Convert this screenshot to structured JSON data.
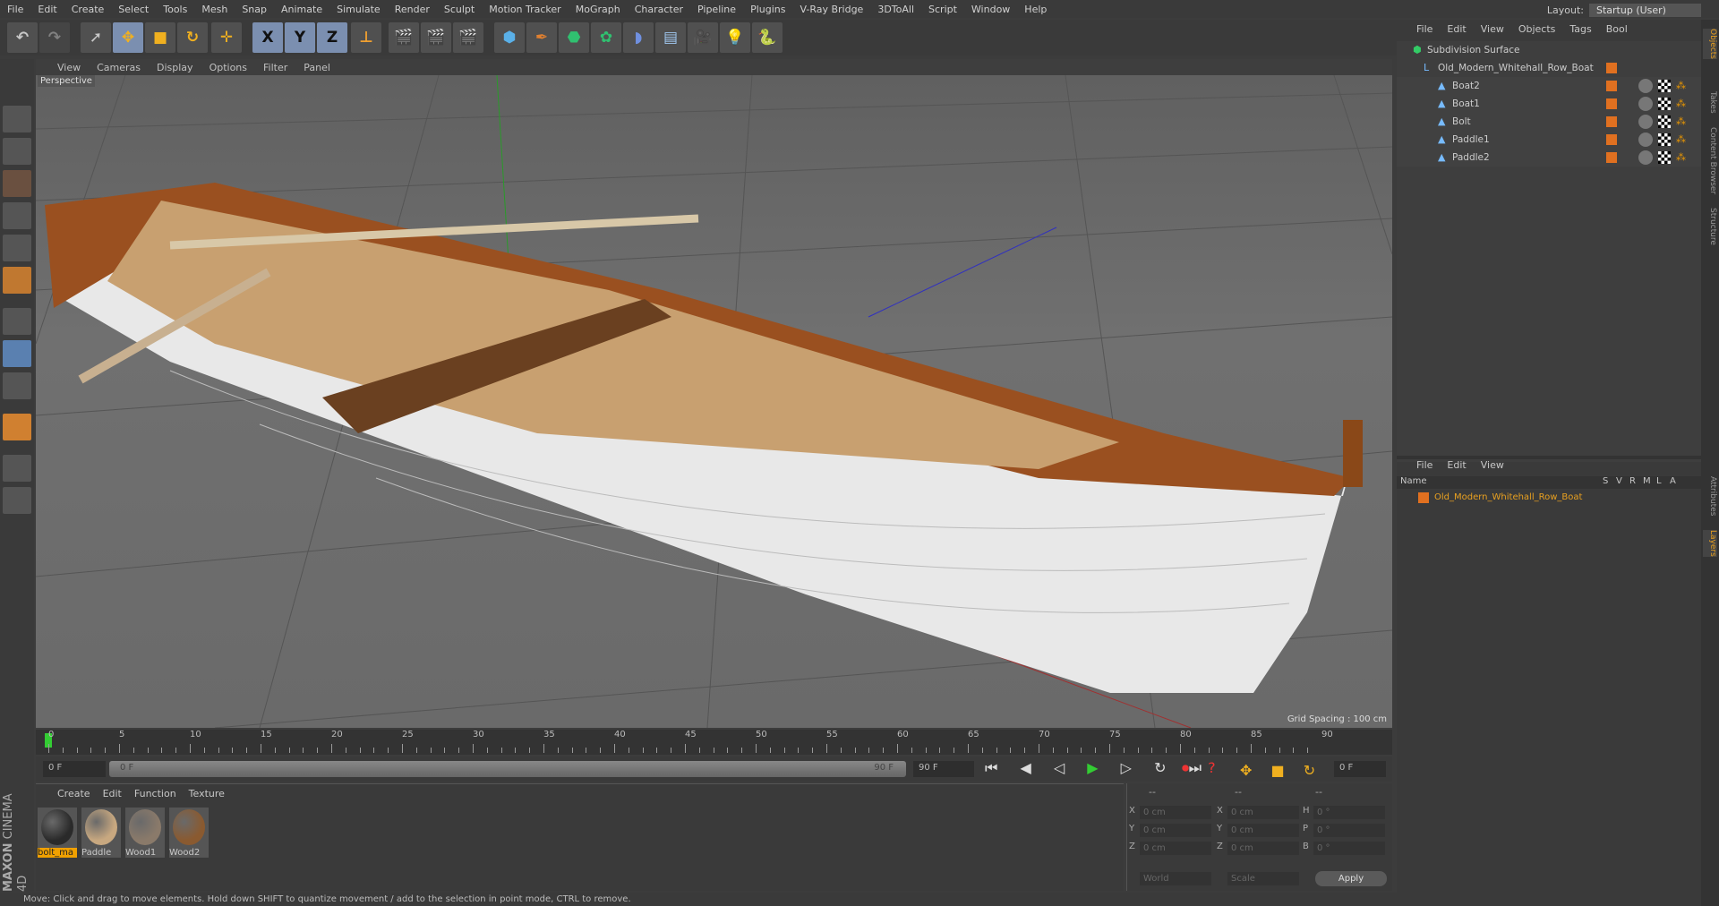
{
  "menu": [
    "File",
    "Edit",
    "Create",
    "Select",
    "Tools",
    "Mesh",
    "Snap",
    "Animate",
    "Simulate",
    "Render",
    "Sculpt",
    "Motion Tracker",
    "MoGraph",
    "Character",
    "Pipeline",
    "Plugins",
    "V-Ray Bridge",
    "3DToAll",
    "Script",
    "Window",
    "Help"
  ],
  "layout": {
    "label": "Layout:",
    "value": "Startup (User)"
  },
  "toolbar": {
    "x": "X",
    "y": "Y",
    "z": "Z"
  },
  "viewport": {
    "menu": [
      "View",
      "Cameras",
      "Display",
      "Options",
      "Filter",
      "Panel"
    ],
    "camera": "Perspective",
    "grid_spacing": "Grid Spacing : 100 cm"
  },
  "timeline": {
    "ticks": [
      "0",
      "5",
      "10",
      "15",
      "20",
      "25",
      "30",
      "35",
      "40",
      "45",
      "50",
      "55",
      "60",
      "65",
      "70",
      "75",
      "80",
      "85",
      "90"
    ],
    "current_frame": "0 F",
    "start": "0 F",
    "slider_start": "0 F",
    "slider_end": "90 F",
    "end": "90 F",
    "right_frame": "0 F"
  },
  "materials": {
    "menu": [
      "Create",
      "Edit",
      "Function",
      "Texture"
    ],
    "items": [
      {
        "name": "bolt_ma",
        "color": "#2a2a2a"
      },
      {
        "name": "Paddle",
        "color": "#c8a880"
      },
      {
        "name": "Wood1",
        "color": "#8a7a6a"
      },
      {
        "name": "Wood2",
        "color": "#8a5a30"
      }
    ],
    "brand1": "MAXON",
    "brand2": "CINEMA 4D"
  },
  "coords": {
    "headers": [
      "--",
      "--",
      "--"
    ],
    "rows": [
      {
        "a": "X",
        "av": "0 cm",
        "b": "X",
        "bv": "0 cm",
        "c": "H",
        "cv": "0 °"
      },
      {
        "a": "Y",
        "av": "0 cm",
        "b": "Y",
        "bv": "0 cm",
        "c": "P",
        "cv": "0 °"
      },
      {
        "a": "Z",
        "av": "0 cm",
        "b": "Z",
        "bv": "0 cm",
        "c": "B",
        "cv": "0 °"
      }
    ],
    "world": "World",
    "scale": "Scale",
    "apply": "Apply"
  },
  "objects": {
    "menu": [
      "File",
      "Edit",
      "View",
      "Objects",
      "Tags",
      "Bool"
    ],
    "items": [
      "Subdivision Surface",
      "Old_Modern_Whitehall_Row_Boat",
      "Boat2",
      "Boat1",
      "Bolt",
      "Paddle1",
      "Paddle2"
    ]
  },
  "layers": {
    "menu": [
      "File",
      "Edit",
      "View"
    ],
    "cols": [
      "Name",
      "S",
      "V",
      "R",
      "M",
      "L",
      "A"
    ],
    "item": "Old_Modern_Whitehall_Row_Boat"
  },
  "right_tabs": [
    "Objects",
    "Takes",
    "Content Browser",
    "Structure",
    "Attributes",
    "Layers"
  ],
  "status": "Move: Click and drag to move elements. Hold down SHIFT to quantize movement / add to the selection in point mode, CTRL to remove."
}
